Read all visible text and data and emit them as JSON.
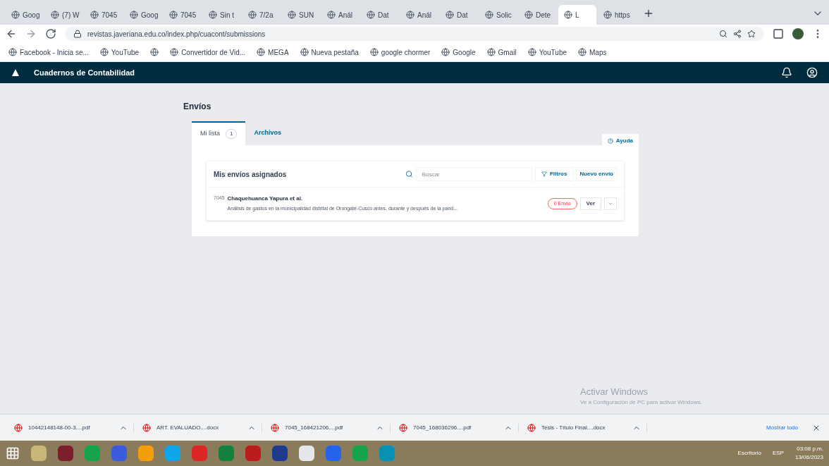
{
  "browser": {
    "tabs": [
      {
        "label": "Goog",
        "selected": false
      },
      {
        "label": "(7) W",
        "selected": false
      },
      {
        "label": "7045",
        "selected": false
      },
      {
        "label": "Goog",
        "selected": false
      },
      {
        "label": "7045",
        "selected": false
      },
      {
        "label": "Sin t",
        "selected": false
      },
      {
        "label": "7/2a",
        "selected": false
      },
      {
        "label": "SUN",
        "selected": false
      },
      {
        "label": "Anál",
        "selected": false
      },
      {
        "label": "Dat",
        "selected": false
      },
      {
        "label": "Anál",
        "selected": false
      },
      {
        "label": "Dat",
        "selected": false
      },
      {
        "label": "Solic",
        "selected": false
      },
      {
        "label": "Dete",
        "selected": false
      },
      {
        "label": "L",
        "selected": true
      },
      {
        "label": "https",
        "selected": false
      }
    ],
    "address": "revistas.javeriana.edu.co/index.php/cuacont/submissions",
    "bookmarks": [
      {
        "kind": "link",
        "label": "Facebook - Inicia se..."
      },
      {
        "kind": "link",
        "label": "YouTube"
      },
      {
        "kind": "icon"
      },
      {
        "kind": "link",
        "label": "Convertidor de Vid..."
      },
      {
        "kind": "link",
        "label": "MEGA"
      },
      {
        "kind": "link",
        "label": "Nueva pestaña"
      },
      {
        "kind": "link",
        "label": "google chormer"
      },
      {
        "kind": "link",
        "label": "Google"
      },
      {
        "kind": "link",
        "label": "Gmail"
      },
      {
        "kind": "link",
        "label": "YouTube"
      },
      {
        "kind": "link",
        "label": "Maps"
      }
    ]
  },
  "app": {
    "title": "Cuadernos de Contabilidad"
  },
  "page": {
    "heading": "Envíos",
    "tabs": [
      {
        "label": "Mi lista",
        "count": "1",
        "selected": true
      },
      {
        "label": "Archivos",
        "selected": false
      }
    ],
    "help": "Ayuda",
    "list": {
      "title": "Mis envíos asignados",
      "search": {
        "placeholder": "Buscar"
      },
      "filters": "Filtros",
      "new": "Nuevo envío",
      "rows": [
        {
          "id": "7045",
          "authors": "Chaquehuanca Yapura et al.",
          "title": "Análisis de gastos en la municipalidad distrital de Orongate-Cusco antes, durante y después de la pand...",
          "badge": "0 Envío",
          "view": "Ver",
          "expanded": false
        }
      ]
    }
  },
  "watermark": {
    "title": "Activar Windows",
    "text": "Ve a Configuración de PC para activar Windows."
  },
  "downloads": {
    "items": [
      "10442148148-00-3....pdf",
      "ART. EVALUADO....docx",
      "7045_168421206....pdf",
      "7045_168036296....pdf",
      "Tesis - Título Final....docx"
    ],
    "show_all": "Mostrar todo"
  },
  "taskbar": {
    "search": "Escritorio",
    "language": "ESP",
    "time": "03:08 p.m.",
    "date": "13/06/2023"
  }
}
